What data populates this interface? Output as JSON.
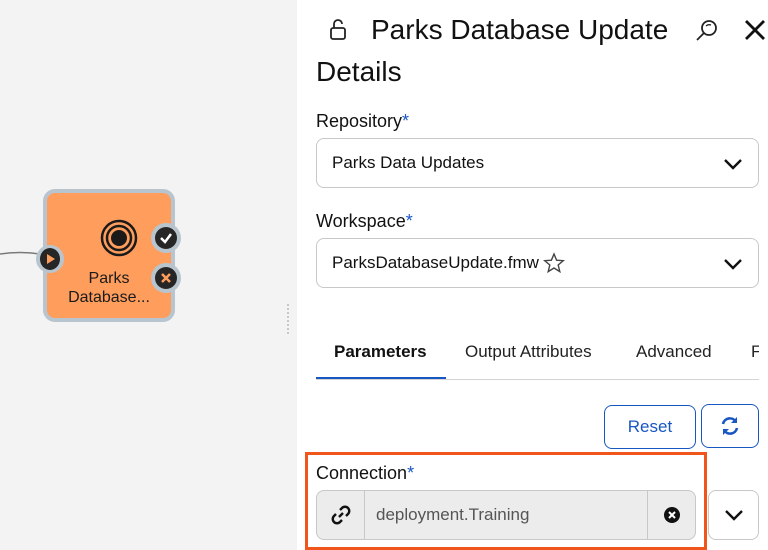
{
  "canvas": {
    "node": {
      "label_line1": "Parks",
      "label_line2": "Database..."
    }
  },
  "panel": {
    "title": "Parks Database Update",
    "section_title": "Details",
    "repository": {
      "label": "Repository",
      "required_mark": "*",
      "value": "Parks Data Updates"
    },
    "workspace": {
      "label": "Workspace",
      "required_mark": "*",
      "value": "ParksDatabaseUpdate.fmw"
    },
    "tabs": [
      {
        "label": "Parameters",
        "active": true
      },
      {
        "label": "Output Attributes",
        "active": false
      },
      {
        "label": "Advanced",
        "active": false
      },
      {
        "label": "F",
        "active": false
      }
    ],
    "reset_label": "Reset",
    "connection": {
      "label": "Connection",
      "required_mark": "*",
      "value": "deployment.Training"
    }
  },
  "colors": {
    "accent": "#1856c2",
    "node_fill": "#ff9d5c",
    "highlight": "#f0561c"
  },
  "icons": [
    "lock-open-icon",
    "search-icon",
    "close-icon",
    "chevron-down-icon",
    "star-icon",
    "refresh-icon",
    "link-icon",
    "clear-icon",
    "target-icon",
    "play-icon",
    "check-icon",
    "x-icon"
  ]
}
